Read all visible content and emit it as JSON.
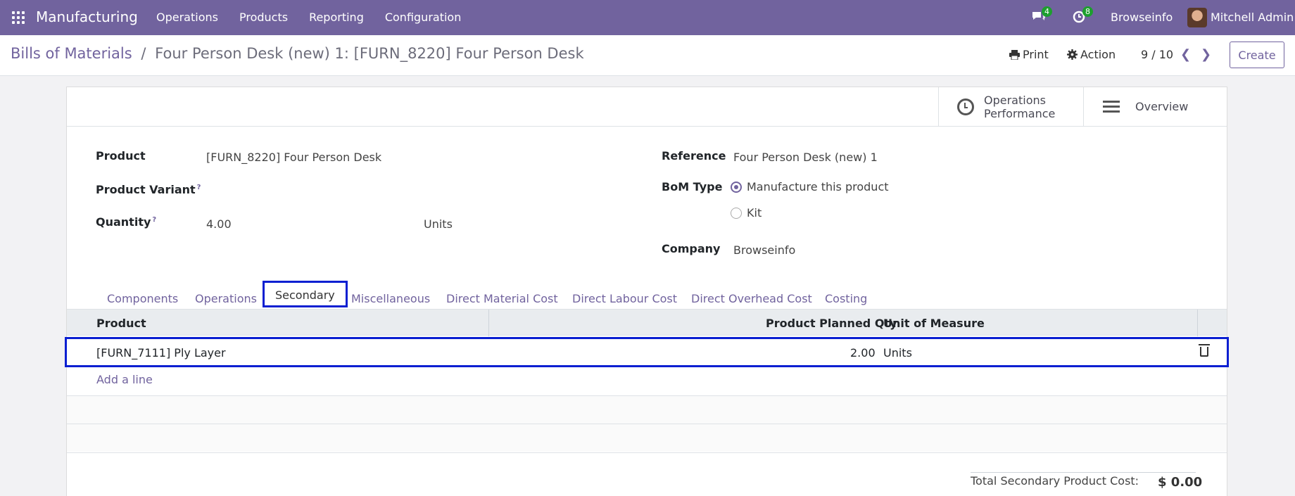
{
  "navbar": {
    "brand": "Manufacturing",
    "menu": [
      "Operations",
      "Products",
      "Reporting",
      "Configuration"
    ],
    "messages_badge": "4",
    "activities_badge": "8",
    "company": "Browseinfo",
    "user": "Mitchell Admin"
  },
  "control": {
    "breadcrumb_parent": "Bills of Materials",
    "breadcrumb_sep": "/",
    "breadcrumb_current": "Four Person Desk (new) 1: [FURN_8220] Four Person Desk",
    "print": "Print",
    "action": "Action",
    "pager": "9 / 10",
    "create": "Create"
  },
  "smart_buttons": {
    "operations_line1": "Operations",
    "operations_line2": "Performance",
    "overview": "Overview"
  },
  "form": {
    "product_label": "Product",
    "product_value": "[FURN_8220] Four Person Desk",
    "variant_label": "Product Variant",
    "quantity_label": "Quantity",
    "quantity_value": "4.00",
    "quantity_uom": "Units",
    "help_mark": "?",
    "reference_label": "Reference",
    "reference_value": "Four Person Desk (new) 1",
    "bom_type_label": "BoM Type",
    "bom_type_options": [
      "Manufacture this product",
      "Kit"
    ],
    "bom_type_selected": "Manufacture this product",
    "company_label": "Company",
    "company_value": "Browseinfo"
  },
  "tabs": [
    "Components",
    "Operations",
    "Secondary",
    "Miscellaneous",
    "Direct Material Cost",
    "Direct Labour Cost",
    "Direct Overhead Cost",
    "Costing"
  ],
  "active_tab": "Secondary",
  "table": {
    "headers": [
      "Product",
      "Product Planned Qty",
      "Unit of Measure"
    ],
    "rows": [
      {
        "product": "[FURN_7111] Ply Layer",
        "qty": "2.00",
        "uom": "Units"
      }
    ],
    "add_line": "Add a line"
  },
  "total": {
    "label": "Total Secondary Product Cost:",
    "value": "$ 0.00"
  }
}
